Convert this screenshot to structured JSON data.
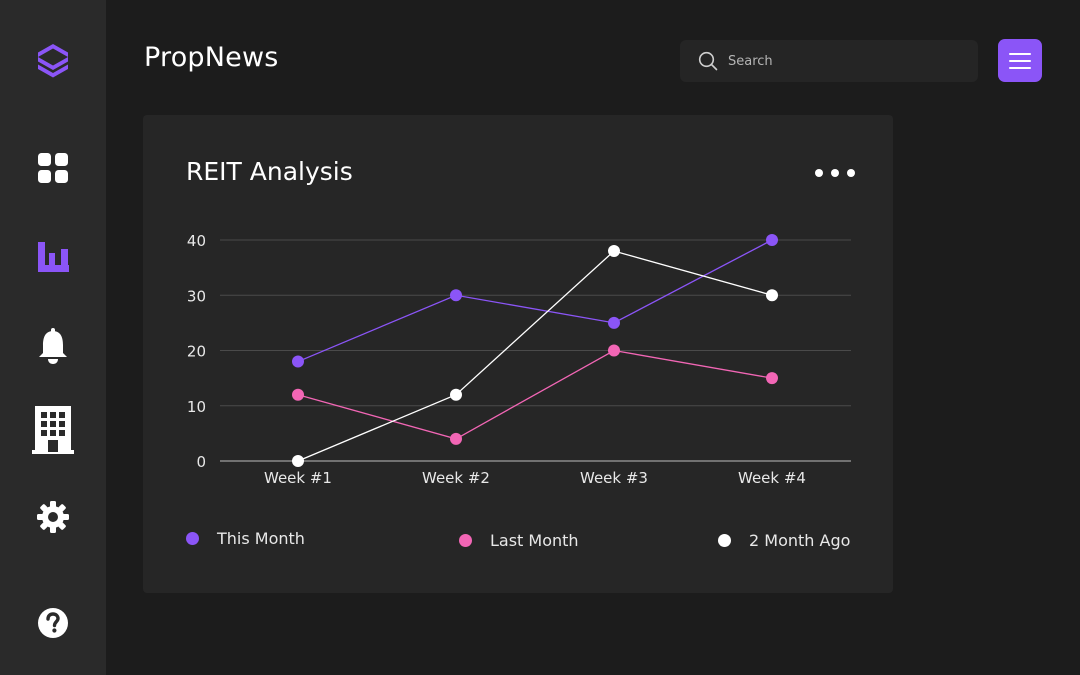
{
  "app": {
    "brand": "PropNews"
  },
  "search": {
    "placeholder": "Search"
  },
  "colors": {
    "accent": "#8b55f7",
    "this_month": "#8b55f7",
    "last_month": "#f266b5",
    "two_month": "#ffffff"
  },
  "sidebar": {
    "items": [
      {
        "icon": "logo-icon"
      },
      {
        "icon": "dashboard-icon"
      },
      {
        "icon": "bar-chart-icon",
        "active": true
      },
      {
        "icon": "bell-icon"
      },
      {
        "icon": "building-icon"
      },
      {
        "icon": "gear-icon"
      },
      {
        "icon": "help-icon"
      }
    ]
  },
  "card": {
    "title": "REIT Analysis"
  },
  "chart_data": {
    "type": "line",
    "title": "REIT Analysis",
    "categories": [
      "Week #1",
      "Week #2",
      "Week #3",
      "Week #4"
    ],
    "ylim": [
      0,
      40
    ],
    "yticks": [
      "0",
      "10",
      "20",
      "30",
      "40"
    ],
    "grid": true,
    "legend_position": "bottom",
    "series": [
      {
        "name": "This Month",
        "color": "#8b55f7",
        "values": [
          18,
          30,
          25,
          40
        ]
      },
      {
        "name": "Last Month",
        "color": "#f266b5",
        "values": [
          12,
          4,
          20,
          15
        ]
      },
      {
        "name": "2 Month Ago",
        "color": "#ffffff",
        "values": [
          0,
          12,
          38,
          30
        ]
      }
    ]
  }
}
